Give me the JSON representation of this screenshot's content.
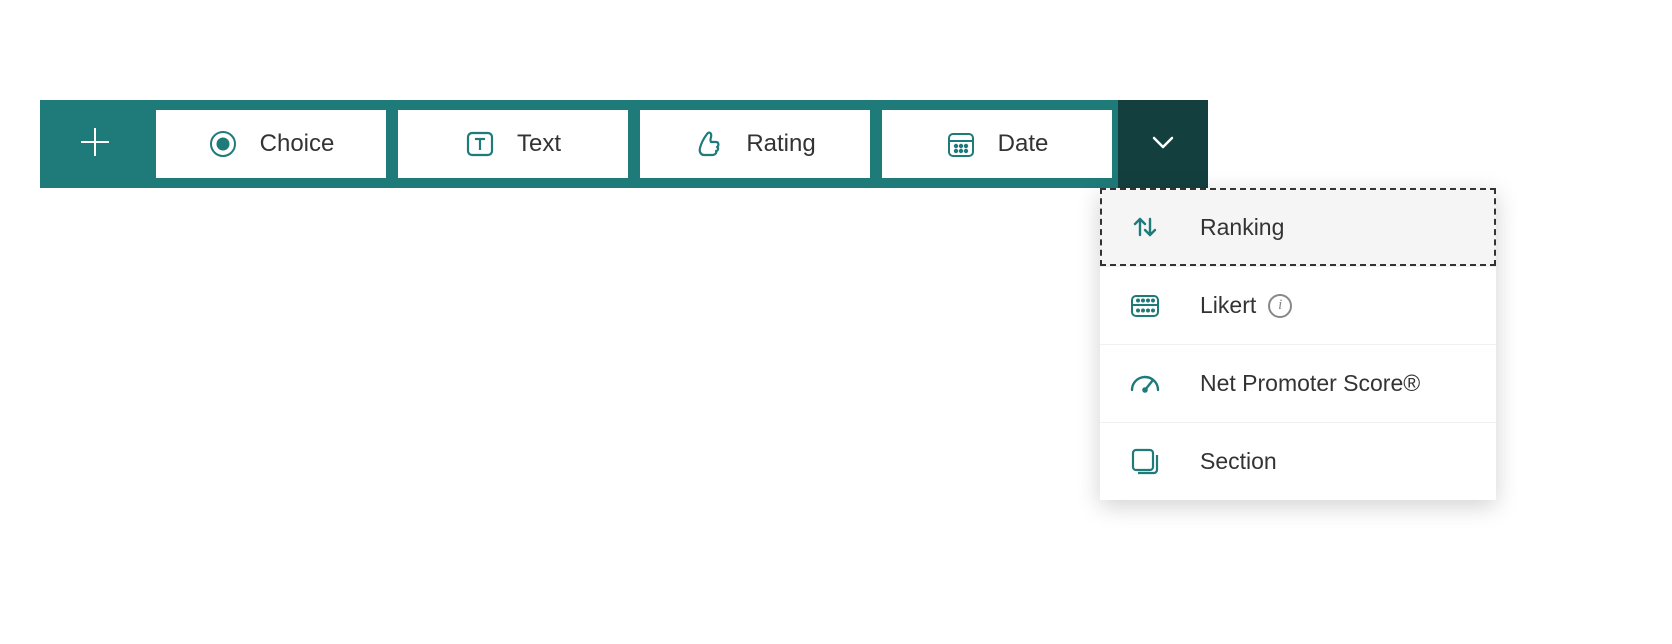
{
  "toolbar": {
    "add_label": "Add new",
    "types": [
      {
        "id": "choice",
        "label": "Choice",
        "icon": "radio-icon"
      },
      {
        "id": "text",
        "label": "Text",
        "icon": "text-icon"
      },
      {
        "id": "rating",
        "label": "Rating",
        "icon": "thumb-icon"
      },
      {
        "id": "date",
        "label": "Date",
        "icon": "calendar-icon"
      }
    ],
    "more_label": "More question types"
  },
  "dropdown": {
    "items": [
      {
        "id": "ranking",
        "label": "Ranking",
        "icon": "ranking-icon",
        "highlight": true
      },
      {
        "id": "likert",
        "label": "Likert",
        "icon": "likert-icon",
        "info": true
      },
      {
        "id": "nps",
        "label": "Net Promoter Score®",
        "icon": "gauge-icon"
      },
      {
        "id": "section",
        "label": "Section",
        "icon": "section-icon"
      }
    ]
  },
  "colors": {
    "accent": "#1f7a7a",
    "accent_dark": "#13403f"
  }
}
